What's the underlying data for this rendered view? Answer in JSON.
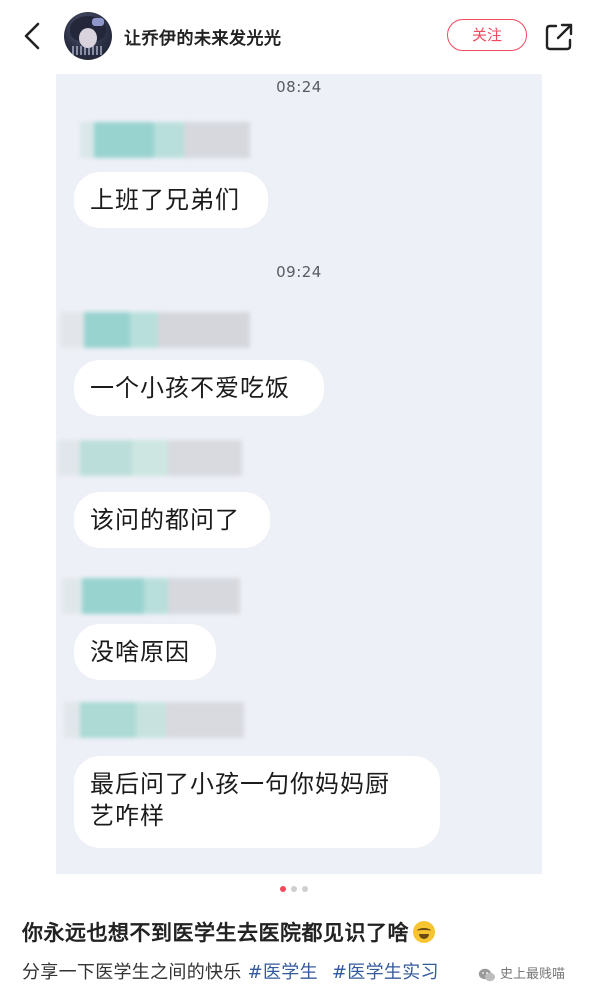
{
  "header": {
    "username": "让乔伊的未来发光光",
    "follow_label": "关注"
  },
  "chat": {
    "messages": [
      {
        "timestamp": "08:24",
        "text": "上班了兄弟们"
      },
      {
        "timestamp": "09:24",
        "text": "一个小孩不爱吃饭"
      },
      {
        "text": "该问的都问了"
      },
      {
        "text": "没啥原因"
      },
      {
        "text": "最后问了小孩一句你妈妈厨",
        "text_line2": "艺咋样"
      }
    ]
  },
  "pager": {
    "count": 3,
    "active_index": 0
  },
  "post": {
    "title": "你永远也想不到医学生去医院都见识了啥",
    "title_emoji": "face-with-tears-of-joy-icon",
    "body": "分享一下医学生之间的快乐",
    "hashtags": [
      "#医学生",
      "#医学生实习"
    ]
  },
  "watermark": {
    "text": "史上最贱喵"
  },
  "colors": {
    "accent": "#f2485e",
    "hashtag": "#355a9c",
    "chat_background": "#eef0f7"
  }
}
